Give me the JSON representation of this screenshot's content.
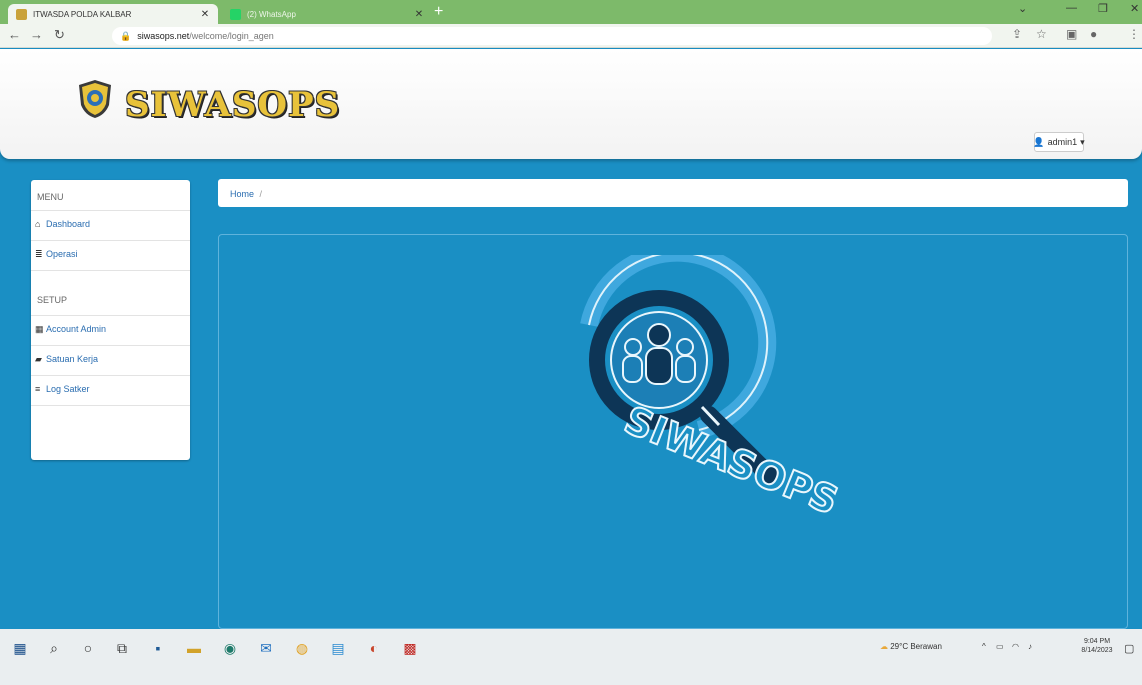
{
  "browser": {
    "tabs": [
      {
        "label": "ITWASDA POLDA KALBAR",
        "active": true
      },
      {
        "label": "(2) WhatsApp",
        "active": false
      }
    ],
    "address_host": "siwasops.net",
    "address_path": "/welcome/login_agen"
  },
  "header": {
    "brand": "SIWASOPS",
    "user_label": "admin1"
  },
  "sidebar": {
    "menu_heading": "MENU",
    "menu_items": [
      {
        "label": "Dashboard",
        "icon": "home-icon"
      },
      {
        "label": "Operasi",
        "icon": "list-icon"
      }
    ],
    "setup_heading": "SETUP",
    "setup_items": [
      {
        "label": "Account Admin",
        "icon": "table-icon"
      },
      {
        "label": "Satuan Kerja",
        "icon": "comment-icon"
      },
      {
        "label": "Log Satker",
        "icon": "log-icon"
      }
    ]
  },
  "breadcrumb": {
    "home": "Home",
    "separator": "/"
  },
  "hero": {
    "wordmark": "SIWASOPS"
  },
  "taskbar": {
    "weather": "29°C  Berawan",
    "time": "9:04 PM",
    "date": "8/14/2023"
  },
  "colors": {
    "page_bg": "#1a8fc4",
    "tabstrip": "#7dba6a",
    "brand_gold": "#e8c23a",
    "link_blue": "#2a6db0"
  }
}
